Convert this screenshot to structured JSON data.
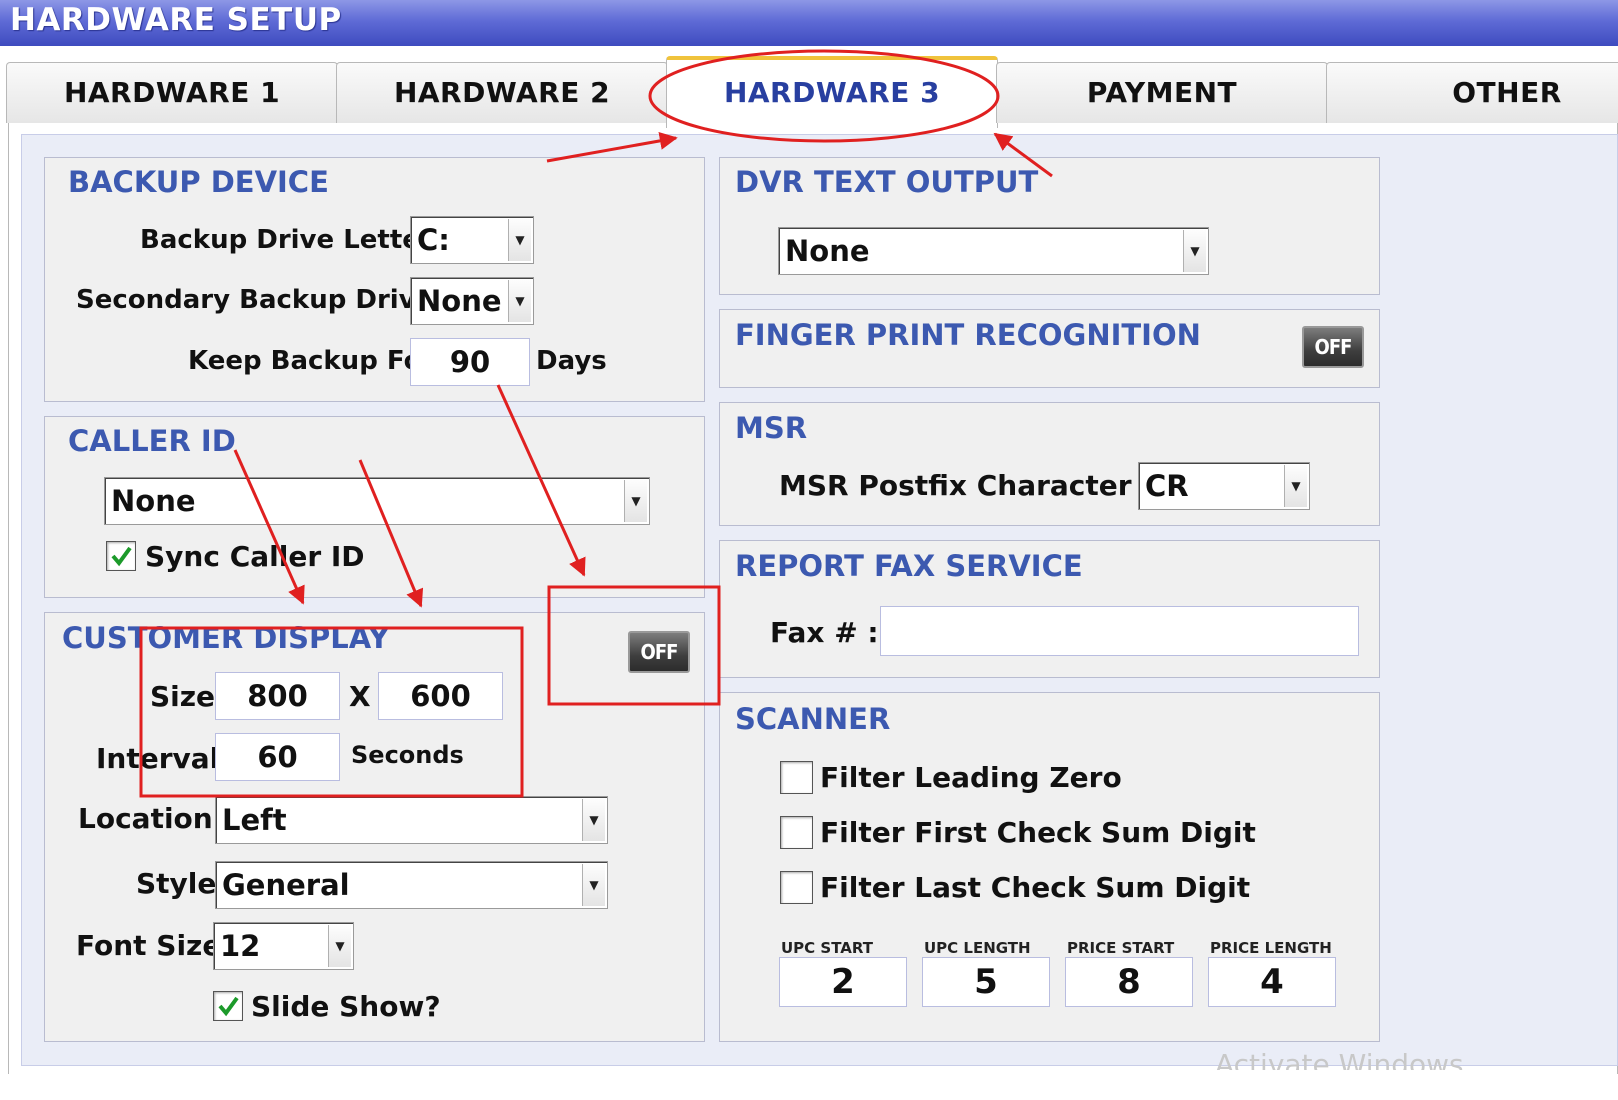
{
  "window": {
    "title": "HARDWARE SETUP"
  },
  "tabs": [
    "HARDWARE 1",
    "HARDWARE 2",
    "HARDWARE 3",
    "PAYMENT",
    "OTHER"
  ],
  "active_tab": "HARDWARE 3",
  "backup_device": {
    "title": "BACKUP DEVICE",
    "drive_letter_label": "Backup Drive Letter :",
    "drive_letter_value": "C:",
    "secondary_label": "Secondary Backup Drive:",
    "secondary_value": "None",
    "keep_label": "Keep Backup For",
    "keep_value": "90",
    "keep_unit": "Days"
  },
  "caller_id": {
    "title": "CALLER ID",
    "device_value": "None",
    "sync_label": "Sync Caller ID",
    "sync_checked": true
  },
  "customer_display": {
    "title": "CUSTOMER DISPLAY",
    "toggle": "OFF",
    "size_label": "Size",
    "width": "800",
    "x_label": "X",
    "height": "600",
    "interval_label": "Interval",
    "interval_value": "60",
    "interval_unit": "Seconds",
    "location_label": "Location",
    "location_value": "Left",
    "style_label": "Style",
    "style_value": "General",
    "font_size_label": "Font Size",
    "font_size_value": "12",
    "slide_show_label": "Slide Show?",
    "slide_show_checked": true
  },
  "dvr_text_output": {
    "title": "DVR TEXT OUTPUT",
    "value": "None"
  },
  "finger_print": {
    "title": "FINGER PRINT RECOGNITION",
    "toggle": "OFF"
  },
  "msr": {
    "title": "MSR",
    "postfix_label": "MSR Postfix Character :",
    "postfix_value": "CR"
  },
  "report_fax": {
    "title": "REPORT FAX SERVICE",
    "fax_label": "Fax # :",
    "fax_value": ""
  },
  "scanner": {
    "title": "SCANNER",
    "filter_leading_zero": "Filter Leading Zero",
    "filter_first_checksum": "Filter First Check Sum Digit",
    "filter_last_checksum": "Filter Last Check Sum Digit",
    "upc_start_label": "UPC START",
    "upc_start": "2",
    "upc_length_label": "UPC LENGTH",
    "upc_length": "5",
    "price_start_label": "PRICE START",
    "price_start": "8",
    "price_length_label": "PRICE LENGTH",
    "price_length": "4"
  },
  "annotations": {
    "color": "#e02020"
  },
  "watermark": "Activate Windows"
}
